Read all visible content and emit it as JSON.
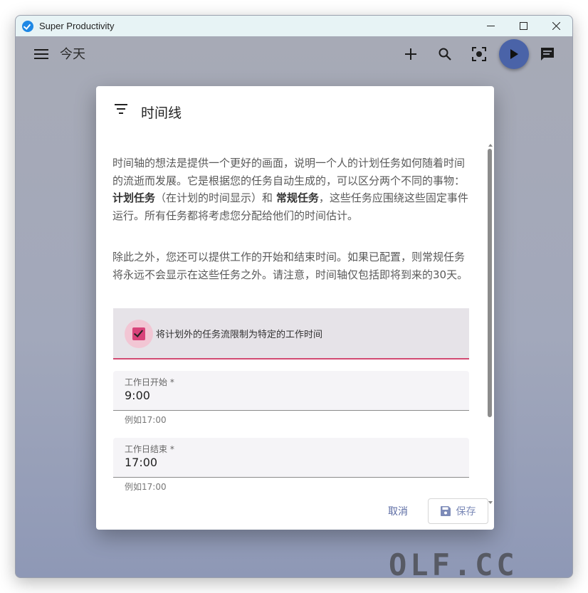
{
  "window": {
    "title": "Super Productivity",
    "controls": [
      "minimize",
      "maximize",
      "close"
    ]
  },
  "topbar": {
    "page_title": "今天",
    "icons": [
      "menu-icon",
      "add-icon",
      "search-icon",
      "focus-icon",
      "play-icon",
      "chat-icon"
    ]
  },
  "dialog": {
    "title": "时间线",
    "intro_1": {
      "part1": "时间轴的想法是提供一个更好的画面，说明一个人的计划任务如何随着时间的流逝而发展。它是根据您的任务自动生成的，可以区分两个不同的事物：",
      "bold1": "计划任务",
      "part2": "（在计划的时间显示）和",
      "bold2": "常规任务",
      "part3": "，这些任务应围绕这些固定事件运行。所有任务都将考虑您分配给他们的时间估计。"
    },
    "intro_2": "除此之外，您还可以提供工作的开始和结束时间。如果已配置，则常规任务将永远不会显示在这些任务之外。请注意，时间轴仅包括即将到来的30天。",
    "checkbox_label": "将计划外的任务流限制为特定的工作时间",
    "checkbox_checked": true,
    "start_field": {
      "label": "工作日开始 *",
      "value": "9:00",
      "hint": "例如17:00"
    },
    "end_field": {
      "label": "工作日结束 *",
      "value": "17:00",
      "hint": "例如17:00"
    },
    "cancel_label": "取消",
    "save_label": "保存"
  },
  "colors": {
    "accent": "#d8437a",
    "primary": "#4a63a8",
    "button_text": "#5b6ba3"
  },
  "watermark": "OLF.CC"
}
